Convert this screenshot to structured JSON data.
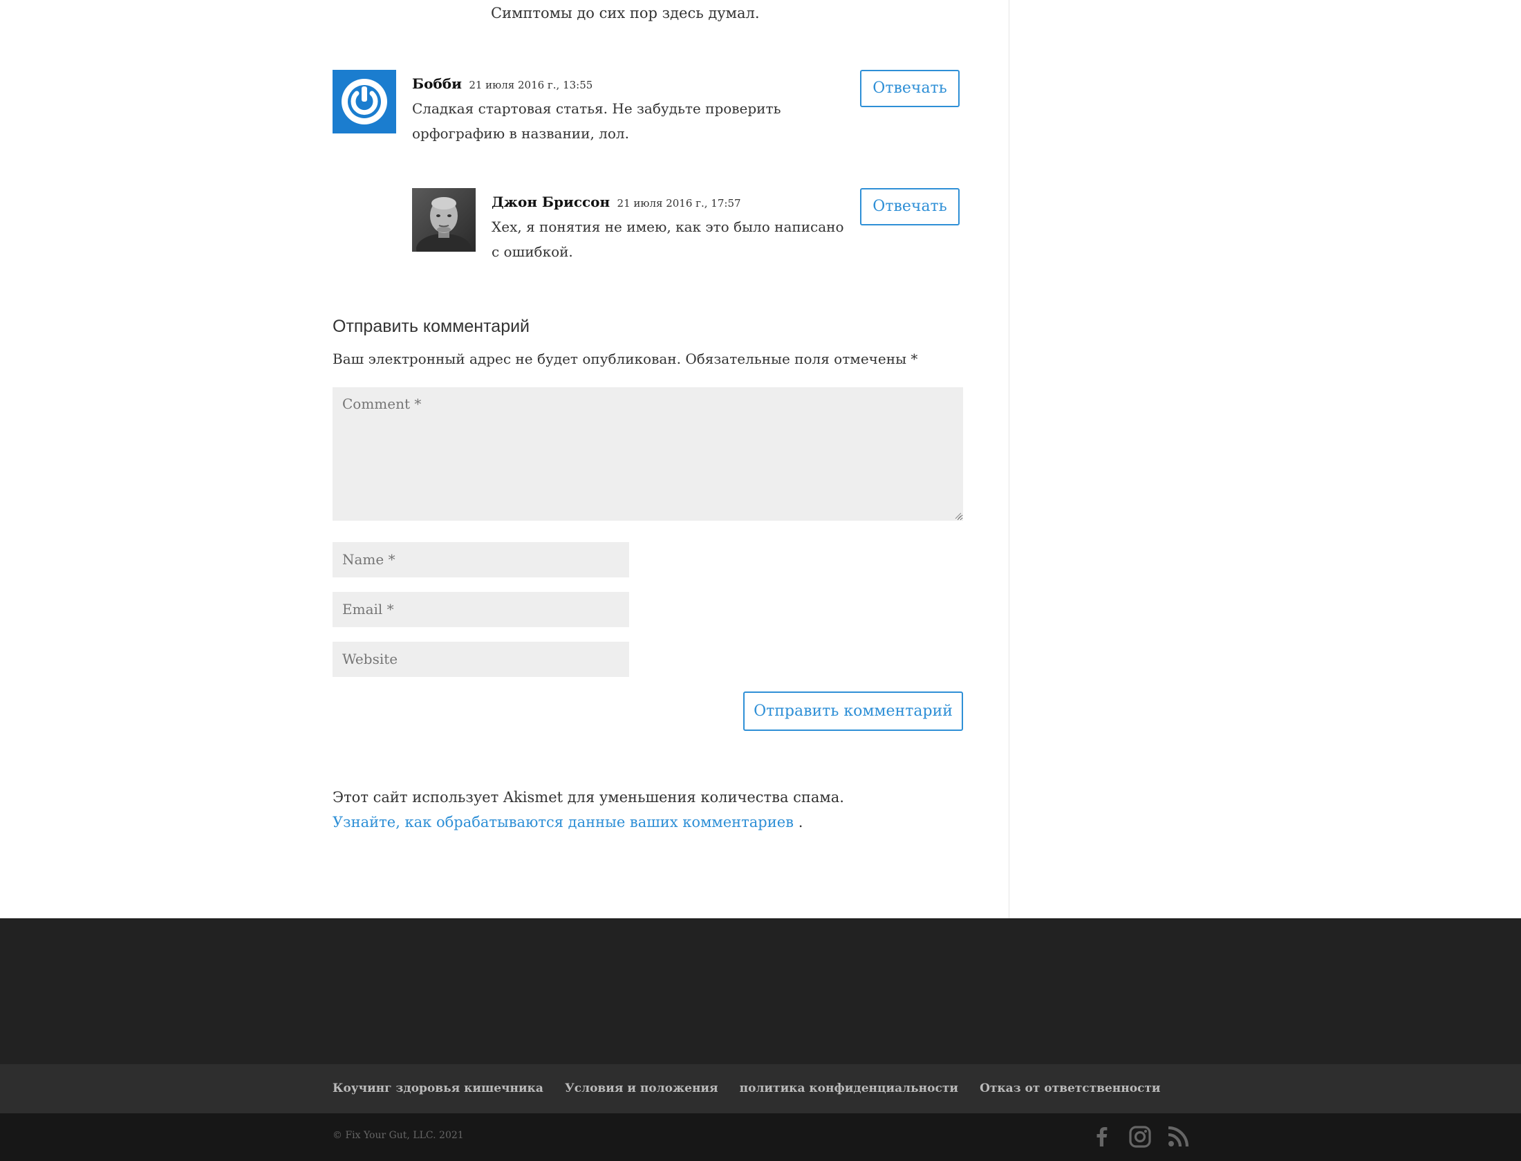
{
  "previous_comment_text": "Симптомы до сих пор здесь думал.",
  "comments": [
    {
      "author": "Бобби",
      "date": "21 июля 2016 г., 13:55",
      "text": "Сладкая стартовая статья. Не забудьте проверить орфографию в названии, лол.",
      "reply_label": "Отвечать"
    },
    {
      "author": "Джон Бриссон",
      "date": "21 июля 2016 г., 17:57",
      "text": "Хех, я понятия не имею, как это было написано с ошибкой.",
      "reply_label": "Отвечать"
    }
  ],
  "respond": {
    "title": "Отправить комментарий",
    "notes": "Ваш электронный адрес не будет опубликован. Обязательные поля отмечены",
    "required_mark": "*",
    "comment_placeholder": "Comment *",
    "name_placeholder": "Name *",
    "email_placeholder": "Email *",
    "website_placeholder": "Website",
    "submit_label": "Отправить комментарий"
  },
  "akismet": {
    "text": "Этот сайт использует Akismet для уменьшения количества спама.",
    "link_text": "Узнайте, как обрабатываются данные ваших комментариев",
    "suffix": "."
  },
  "footer": {
    "menu": [
      "Коучинг здоровья кишечника",
      "Условия и положения",
      "политика конфиденциальности",
      "Отказ от ответственности"
    ],
    "copyright": "© Fix Your Gut, LLC. 2021",
    "social_icons": [
      "facebook-icon",
      "instagram-icon",
      "rss-icon"
    ]
  },
  "colors": {
    "accent": "#2e8fd6",
    "footer_bg": "#222222",
    "footer_menu_bg": "#2e2e2e",
    "footer_bottom_bg": "#171717",
    "field_bg": "#eeeeee"
  }
}
